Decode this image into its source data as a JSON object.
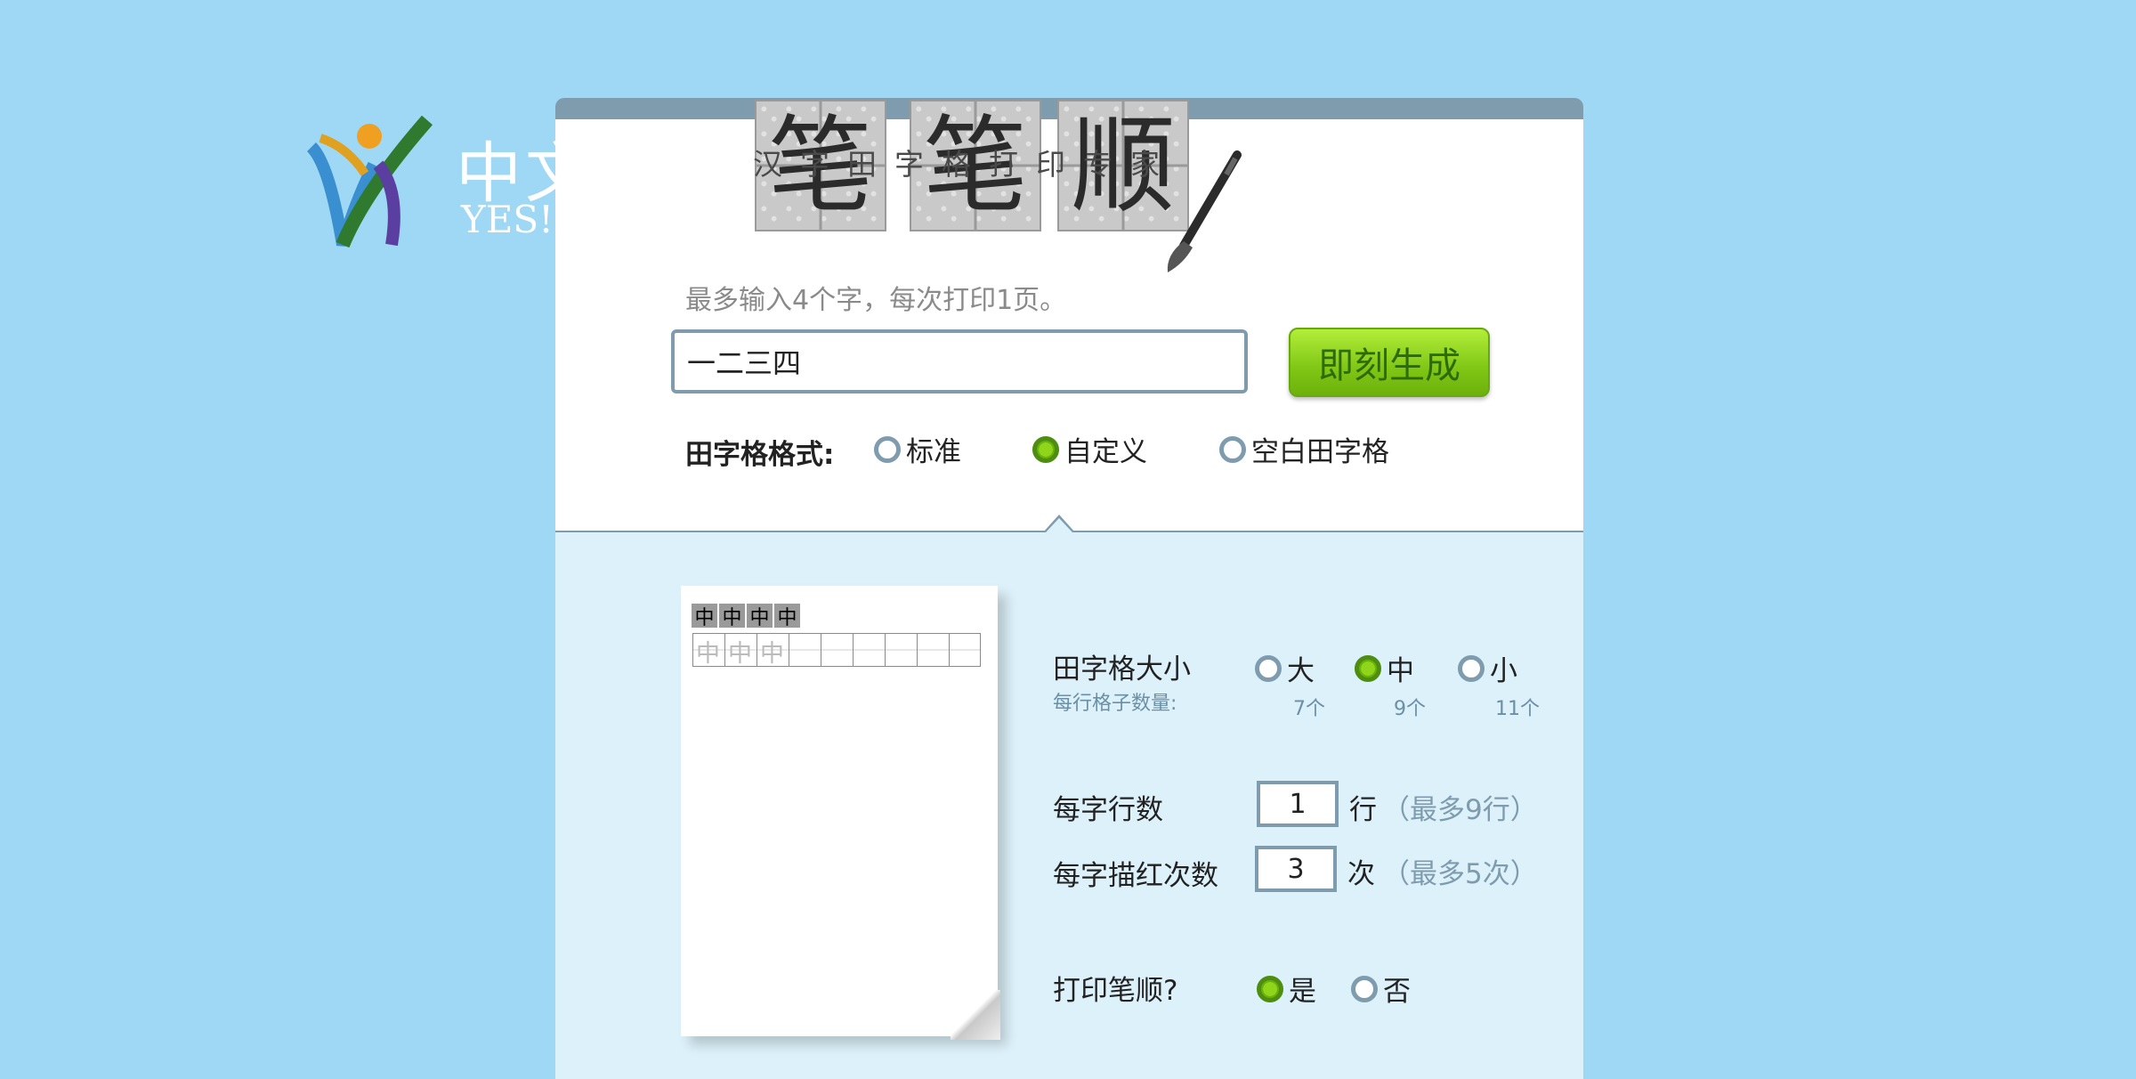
{
  "background_logo": {
    "text_cn": "中文",
    "text_en": "YES! C"
  },
  "header": {
    "logo_chars": [
      "笔",
      "笔",
      "顺"
    ],
    "subtitle": "汉字田字格打印专家"
  },
  "input": {
    "hint": "最多输入4个字，每次打印1页。",
    "value": "一二三四",
    "generate_button": "即刻生成"
  },
  "format": {
    "label": "田字格格式:",
    "options": [
      {
        "label": "标准",
        "selected": false
      },
      {
        "label": "自定义",
        "selected": true
      },
      {
        "label": "空白田字格",
        "selected": false
      }
    ]
  },
  "preview": {
    "chars": [
      "中",
      "中",
      "中",
      "中"
    ],
    "trace": [
      "中",
      "中",
      "中"
    ]
  },
  "settings": {
    "grid_size": {
      "label": "田字格大小",
      "sub": "每行格子数量:",
      "options": [
        {
          "label": "大",
          "count": "7个",
          "selected": false
        },
        {
          "label": "中",
          "count": "9个",
          "selected": true
        },
        {
          "label": "小",
          "count": "11个",
          "selected": false
        }
      ]
    },
    "rows": {
      "label": "每字行数",
      "value": "1",
      "unit": "行",
      "limit": "（最多9行）"
    },
    "trace": {
      "label": "每字描红次数",
      "value": "3",
      "unit": "次",
      "limit": "（最多5次）"
    },
    "stroke_order": {
      "label": "打印笔顺?",
      "options": [
        {
          "label": "是",
          "selected": true
        },
        {
          "label": "否",
          "selected": false
        }
      ]
    }
  },
  "colors": {
    "background": "#9fd8f4",
    "accent_green": "#7fc615",
    "border_gray_blue": "#7f9caf"
  }
}
